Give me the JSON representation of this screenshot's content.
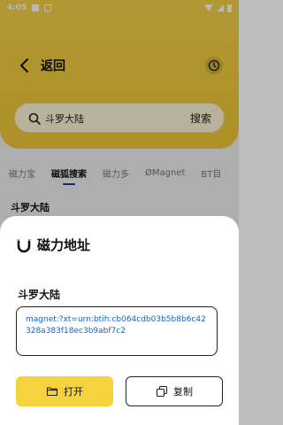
{
  "status_bar": {
    "time": "4:05"
  },
  "header": {
    "back_label": "返回"
  },
  "search": {
    "query": "斗罗大陆",
    "button_label": "搜索"
  },
  "tabs": [
    {
      "label": "磁力宝",
      "active": false
    },
    {
      "label": "磁狐搜索",
      "active": true
    },
    {
      "label": "磁力多",
      "active": false
    },
    {
      "label": "ØMagnet",
      "active": false
    },
    {
      "label": "BT目",
      "active": false
    }
  ],
  "result": {
    "title": "斗罗大陆"
  },
  "sheet": {
    "title": "磁力地址",
    "file_name": "斗罗大陆",
    "magnet": "magnet:?xt=urn:btih:cb064cdb03b5b8b6c42328a383f18ec3b9abf7c2",
    "open_label": "打开",
    "copy_label": "复制"
  },
  "colors": {
    "accent": "#F6D23F",
    "link": "#1462C8"
  },
  "icons": [
    "back-arrow-icon",
    "history-clock-icon",
    "search-icon",
    "magnet-icon",
    "folder-icon",
    "copy-icon"
  ]
}
